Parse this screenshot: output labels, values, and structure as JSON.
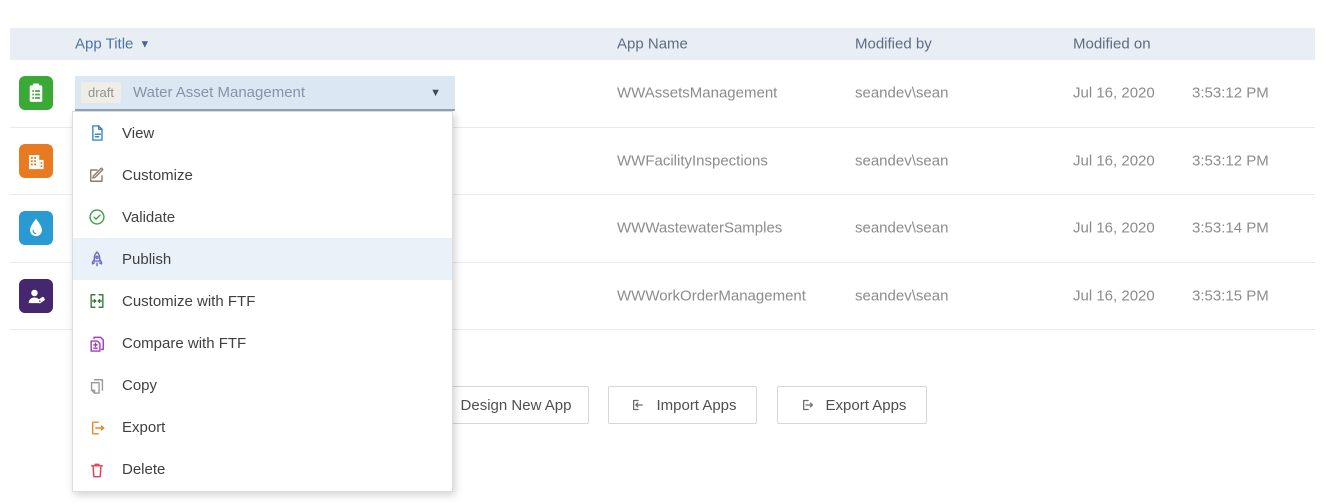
{
  "header": {
    "columns": [
      {
        "label": "App Title",
        "sort_icon": "▼"
      },
      {
        "label": "App Name"
      },
      {
        "label": "Modified by"
      },
      {
        "label": "Modified on"
      }
    ]
  },
  "selected_app": {
    "status_badge": "draft",
    "title": "Water Asset Management",
    "dropdown_icon": "▼"
  },
  "rows": [
    {
      "icon": "clipboard-app-icon",
      "app_name": "WWAssetsManagement",
      "modified_by": "seandev\\sean",
      "modified_date": "Jul 16, 2020",
      "modified_time": "3:53:12 PM"
    },
    {
      "icon": "building-app-icon",
      "app_name": "WWFacilityInspections",
      "modified_by": "seandev\\sean",
      "modified_date": "Jul 16, 2020",
      "modified_time": "3:53:12 PM"
    },
    {
      "icon": "water-drop-app-icon",
      "app_name": "WWWastewaterSamples",
      "modified_by": "seandev\\sean",
      "modified_date": "Jul 16, 2020",
      "modified_time": "3:53:14 PM"
    },
    {
      "icon": "worker-tag-app-icon",
      "app_name": "WWWorkOrderManagement",
      "modified_by": "seandev\\sean",
      "modified_date": "Jul 16, 2020",
      "modified_time": "3:53:15 PM"
    }
  ],
  "context_menu": {
    "items": [
      {
        "label": "View",
        "icon": "view-document-icon",
        "color": "#3d87c9",
        "highlighted": false
      },
      {
        "label": "Customize",
        "icon": "edit-pencil-icon",
        "color": "#8d7b70",
        "highlighted": false
      },
      {
        "label": "Validate",
        "icon": "check-circle-icon",
        "color": "#43a04d",
        "highlighted": false
      },
      {
        "label": "Publish",
        "icon": "rocket-icon",
        "color": "#6a6fc4",
        "highlighted": true
      },
      {
        "label": "Customize with FTF",
        "icon": "brackets-merge-icon",
        "color": "#3a7d44",
        "highlighted": false
      },
      {
        "label": "Compare with FTF",
        "icon": "compare-document-icon",
        "color": "#a03ac0",
        "highlighted": false
      },
      {
        "label": "Copy",
        "icon": "copy-icon",
        "color": "#9a9a9a",
        "highlighted": false
      },
      {
        "label": "Export",
        "icon": "export-icon",
        "color": "#e8872e",
        "highlighted": false
      },
      {
        "label": "Delete",
        "icon": "trash-icon",
        "color": "#e83d52",
        "highlighted": false
      }
    ]
  },
  "buttons": [
    {
      "label": "Design New App"
    },
    {
      "label": "Import Apps",
      "icon": "import-icon"
    },
    {
      "label": "Export Apps",
      "icon": "export-icon"
    }
  ],
  "colors": {
    "header_bg": "#e9eef4",
    "combo_bg": "#dbe7f3",
    "menu_highlight": "#e9f1f9",
    "accent_blue": "#4d74a8",
    "app_icon_green": "#3ba935",
    "app_icon_orange": "#e87a22",
    "app_icon_blue": "#2a9ad2",
    "app_icon_purple": "#44276f"
  }
}
